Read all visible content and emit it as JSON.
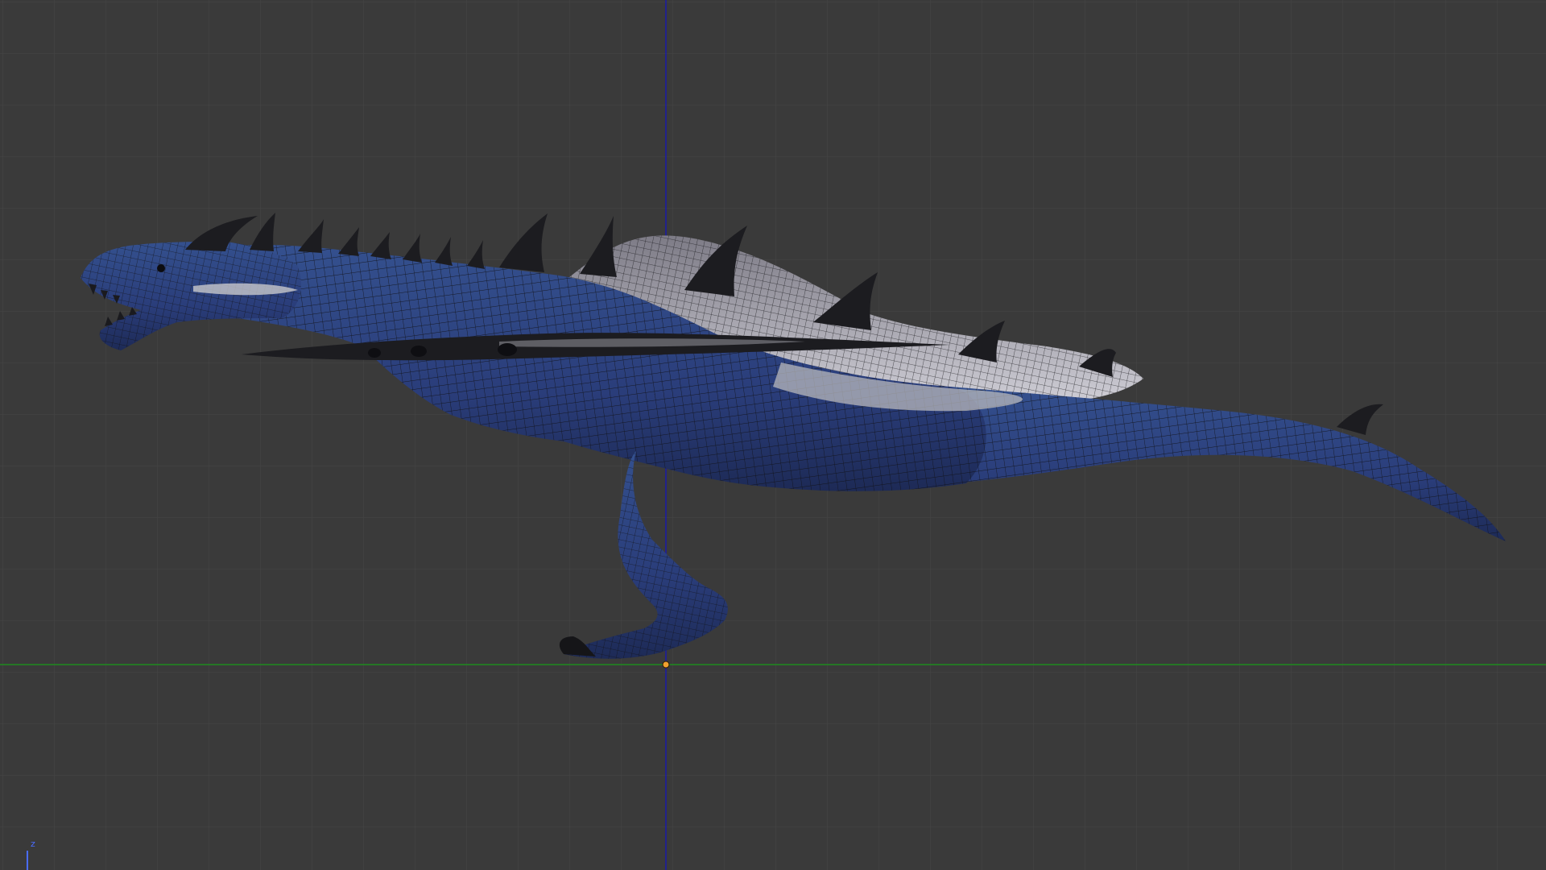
{
  "viewport": {
    "name": "3D Viewport",
    "background_color": "#3a3a3a",
    "grid_color": "#464646",
    "x_axis_color": "#1e8a1e",
    "z_axis_color": "#1a1aa8",
    "origin_color": "#f0a030"
  },
  "model": {
    "subject": "dragon",
    "display_mode": "textured-wireframe",
    "body_color": "#2a3d7a",
    "belly_color": "#b8b8bc",
    "spine_color": "#1c1c20",
    "wire_color": "#101014"
  },
  "axis_gizmo": {
    "z_label": "z",
    "z_color": "#4a6cff"
  }
}
